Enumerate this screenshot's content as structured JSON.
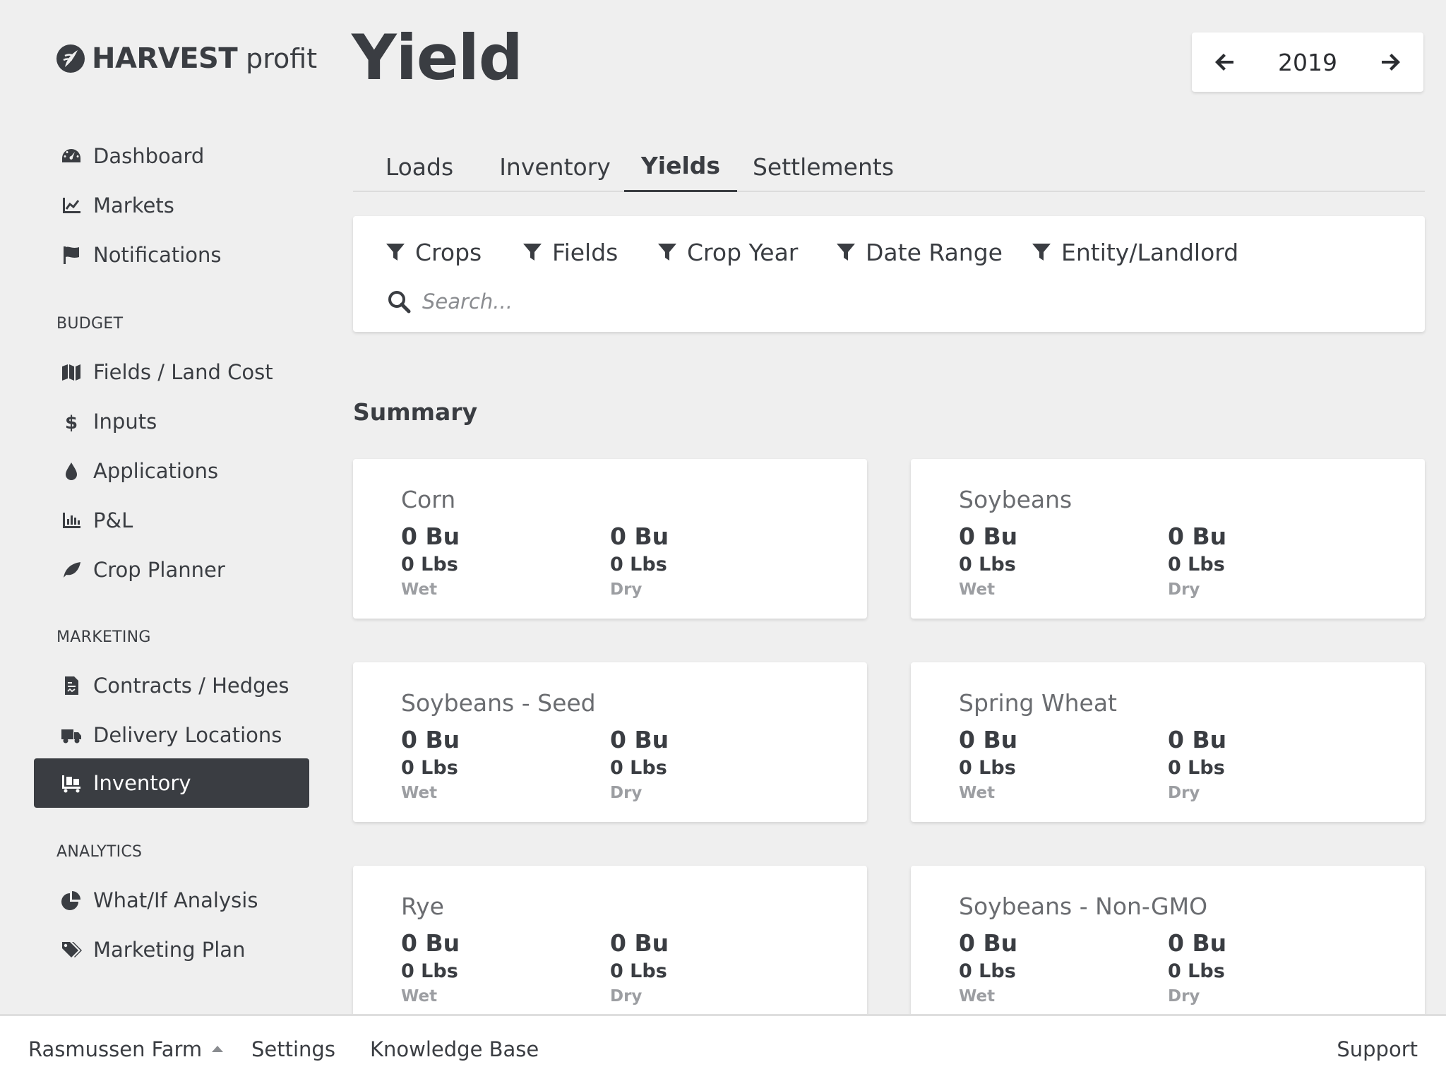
{
  "brand": {
    "name_bold": "HARVEST",
    "name_light": "profit"
  },
  "header": {
    "title": "Yield",
    "year": "2019"
  },
  "sidebar": {
    "top_items": [
      {
        "label": "Dashboard",
        "icon": "dashboard-gauge-icon"
      },
      {
        "label": "Markets",
        "icon": "line-chart-icon"
      },
      {
        "label": "Notifications",
        "icon": "flag-icon"
      }
    ],
    "sections": [
      {
        "title": "BUDGET",
        "items": [
          {
            "label": "Fields / Land Cost",
            "icon": "map-icon"
          },
          {
            "label": "Inputs",
            "icon": "dollar-icon"
          },
          {
            "label": "Applications",
            "icon": "droplet-icon"
          },
          {
            "label": "P&L",
            "icon": "bar-chart-icon"
          },
          {
            "label": "Crop Planner",
            "icon": "leaf-icon"
          }
        ]
      },
      {
        "title": "MARKETING",
        "items": [
          {
            "label": "Contracts / Hedges",
            "icon": "contract-file-icon"
          },
          {
            "label": "Delivery Locations",
            "icon": "truck-icon"
          },
          {
            "label": "Inventory",
            "icon": "pallet-icon",
            "active": true
          }
        ]
      },
      {
        "title": "ANALYTICS",
        "items": [
          {
            "label": "What/If Analysis",
            "icon": "pie-chart-icon"
          },
          {
            "label": "Marketing Plan",
            "icon": "tags-icon"
          }
        ]
      }
    ]
  },
  "tabs": [
    {
      "label": "Loads"
    },
    {
      "label": "Inventory"
    },
    {
      "label": "Yields",
      "active": true
    },
    {
      "label": "Settlements"
    }
  ],
  "filters": [
    {
      "label": "Crops"
    },
    {
      "label": "Fields"
    },
    {
      "label": "Crop Year"
    },
    {
      "label": "Date Range"
    },
    {
      "label": "Entity/Landlord"
    }
  ],
  "search": {
    "placeholder": "Search...",
    "value": ""
  },
  "summary": {
    "title": "Summary",
    "cards": [
      {
        "crop": "Corn",
        "wet": {
          "bu": "0 Bu",
          "lbs": "0 Lbs",
          "label": "Wet"
        },
        "dry": {
          "bu": "0 Bu",
          "lbs": "0 Lbs",
          "label": "Dry"
        }
      },
      {
        "crop": "Soybeans",
        "wet": {
          "bu": "0 Bu",
          "lbs": "0 Lbs",
          "label": "Wet"
        },
        "dry": {
          "bu": "0 Bu",
          "lbs": "0 Lbs",
          "label": "Dry"
        }
      },
      {
        "crop": "Soybeans - Seed",
        "wet": {
          "bu": "0 Bu",
          "lbs": "0 Lbs",
          "label": "Wet"
        },
        "dry": {
          "bu": "0 Bu",
          "lbs": "0 Lbs",
          "label": "Dry"
        }
      },
      {
        "crop": "Spring Wheat",
        "wet": {
          "bu": "0 Bu",
          "lbs": "0 Lbs",
          "label": "Wet"
        },
        "dry": {
          "bu": "0 Bu",
          "lbs": "0 Lbs",
          "label": "Dry"
        }
      },
      {
        "crop": "Rye",
        "wet": {
          "bu": "0 Bu",
          "lbs": "0 Lbs",
          "label": "Wet"
        },
        "dry": {
          "bu": "0 Bu",
          "lbs": "0 Lbs",
          "label": "Dry"
        }
      },
      {
        "crop": "Soybeans - Non-GMO",
        "wet": {
          "bu": "0 Bu",
          "lbs": "0 Lbs",
          "label": "Wet"
        },
        "dry": {
          "bu": "0 Bu",
          "lbs": "0 Lbs",
          "label": "Dry"
        }
      }
    ]
  },
  "footer": {
    "farm": "Rasmussen Farm",
    "settings": "Settings",
    "knowledge_base": "Knowledge Base",
    "support": "Support"
  },
  "colors": {
    "text": "#3a3d42",
    "background": "#efefef",
    "active_nav": "#3a3d42",
    "muted": "#9c9ea2"
  }
}
